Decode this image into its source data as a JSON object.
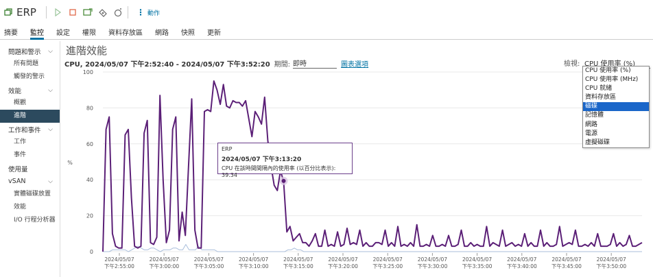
{
  "header": {
    "title": "ERP",
    "actions_label": "動作"
  },
  "tabs": [
    "摘要",
    "監控",
    "設定",
    "權限",
    "資料存放區",
    "網路",
    "快照",
    "更新"
  ],
  "active_tab": "監控",
  "sidebar": {
    "groups": [
      {
        "label": "問題和警示",
        "items": [
          "所有問題",
          "觸發的警示"
        ]
      },
      {
        "label": "效能",
        "items": [
          "概觀",
          "進階"
        ]
      },
      {
        "label": "工作和事件",
        "items": [
          "工作",
          "事件"
        ]
      },
      {
        "label": "使用量",
        "items": []
      },
      {
        "label": "vSAN",
        "items": [
          "實體磁碟放置",
          "效能",
          "I/O 行程分析器"
        ]
      }
    ],
    "active_item": "進階"
  },
  "main": {
    "title": "進階效能",
    "subtitle": "CPU, 2024/05/07 下午2:52:40 - 2024/05/07 下午3:52:20",
    "period_label": "期間:",
    "period_value": "即時",
    "chart_options": "圖表選項",
    "view_label": "檢視:",
    "view_value": "CPU 使用率 (%)",
    "dropdown_options": [
      "CPU 使用率 (%)",
      "CPU 使用率 (MHz)",
      "CPU 就緒",
      "資料存放區",
      "磁碟",
      "記憶體",
      "網路",
      "電源",
      "虛擬磁碟"
    ],
    "dropdown_selected": "磁碟"
  },
  "tooltip": {
    "name": "ERP",
    "time": "2024/05/07 下午3:13:20",
    "text": "CPU 在該時間間隔內的使用率 (以百分比表示): 39.34"
  },
  "colors": {
    "accent": "#0072a3",
    "series_main": "#5b1f77",
    "series_secondary": "#a9bedb",
    "selected": "#1a66c9"
  },
  "chart_data": {
    "type": "line",
    "ylabel": "%",
    "ylim": [
      0,
      100
    ],
    "yticks": [
      0,
      20,
      40,
      60,
      80,
      100
    ],
    "x_ticks": [
      [
        "2024/05/07",
        "下午2:55:00"
      ],
      [
        "2024/05/07",
        "下午3:00:00"
      ],
      [
        "2024/05/07",
        "下午3:05:00"
      ],
      [
        "2024/05/07",
        "下午3:10:00"
      ],
      [
        "2024/05/07",
        "下午3:15:00"
      ],
      [
        "2024/05/07",
        "下午3:20:00"
      ],
      [
        "2024/05/07",
        "下午3:25:00"
      ],
      [
        "2024/05/07",
        "下午3:30:00"
      ],
      [
        "2024/05/07",
        "下午3:35:00"
      ],
      [
        "2024/05/07",
        "下午3:40:00"
      ],
      [
        "2024/05/07",
        "下午3:45:00"
      ],
      [
        "2024/05/07",
        "下午3:50:00"
      ]
    ],
    "series": [
      {
        "values": [
          0,
          68,
          75,
          10,
          3,
          2,
          2,
          65,
          68,
          30,
          3,
          2,
          3,
          66,
          73,
          5,
          4,
          8,
          87,
          40,
          5,
          12,
          68,
          75,
          6,
          22,
          9,
          47,
          85,
          12,
          2,
          2,
          78,
          79,
          78,
          95,
          90,
          82,
          93,
          81,
          80,
          84,
          83,
          83,
          81,
          84,
          74,
          64,
          78,
          75,
          71,
          86,
          62,
          48,
          37,
          34,
          45,
          39,
          11,
          14,
          6,
          8,
          10,
          5,
          5,
          3,
          6,
          10,
          3,
          3,
          12,
          3,
          4,
          3,
          11,
          3,
          4,
          13,
          4,
          5,
          4,
          12,
          3,
          5,
          3,
          3,
          5,
          5,
          4,
          12,
          3,
          5,
          3,
          14,
          3,
          4,
          3,
          5,
          3,
          15,
          3,
          3,
          4,
          3,
          9,
          3,
          3,
          4,
          3,
          9,
          3,
          3,
          4,
          12,
          3,
          3,
          5,
          3,
          4,
          3,
          3,
          14,
          3,
          5,
          4,
          3,
          12,
          3,
          4,
          5,
          3,
          4,
          3,
          10,
          3,
          5,
          3,
          3,
          12,
          3,
          5,
          3,
          3,
          4,
          14,
          3,
          4,
          5,
          4,
          12,
          3,
          3,
          4,
          3,
          5,
          3,
          10,
          3,
          3,
          3,
          4,
          10,
          3,
          5,
          3,
          4,
          9,
          3,
          3,
          4,
          5
        ]
      },
      {
        "values": [
          0,
          0,
          0,
          1,
          1,
          1,
          1,
          1,
          0,
          1,
          2,
          3,
          2,
          1,
          1,
          2,
          2,
          1,
          0,
          1,
          1,
          1,
          2,
          2,
          1,
          1,
          4,
          1,
          1,
          1,
          3,
          1,
          1,
          1,
          1,
          1,
          0,
          0,
          0,
          0,
          0,
          0,
          0,
          0,
          0,
          0,
          0,
          0,
          0,
          0,
          0,
          0,
          0,
          0,
          0,
          0,
          0,
          0,
          1,
          1,
          2,
          1,
          1,
          0,
          0,
          0,
          0,
          0,
          0,
          0,
          0,
          0,
          0,
          0,
          0,
          0,
          0,
          0,
          0,
          0,
          0,
          0,
          0,
          0,
          0,
          0,
          0,
          0,
          0,
          0,
          0,
          0,
          0,
          0,
          0,
          0,
          0,
          0,
          0,
          0,
          0,
          0,
          0,
          0,
          0,
          0,
          0,
          0,
          0,
          0,
          0,
          0,
          0,
          0,
          0,
          0,
          0,
          0,
          0,
          0,
          0,
          0,
          0,
          0,
          0,
          0,
          0,
          0,
          0,
          0,
          0,
          0,
          0,
          0,
          0,
          0,
          0,
          0,
          0,
          0,
          0,
          0,
          0,
          0,
          0,
          0,
          0,
          0,
          0,
          0,
          0,
          0,
          0,
          0,
          0,
          0,
          0,
          0,
          0,
          0,
          0,
          0,
          0,
          0,
          0,
          0,
          0,
          0,
          0,
          0
        ]
      }
    ],
    "highlight": {
      "time": "下午3:13:20",
      "value": 39.34
    }
  }
}
